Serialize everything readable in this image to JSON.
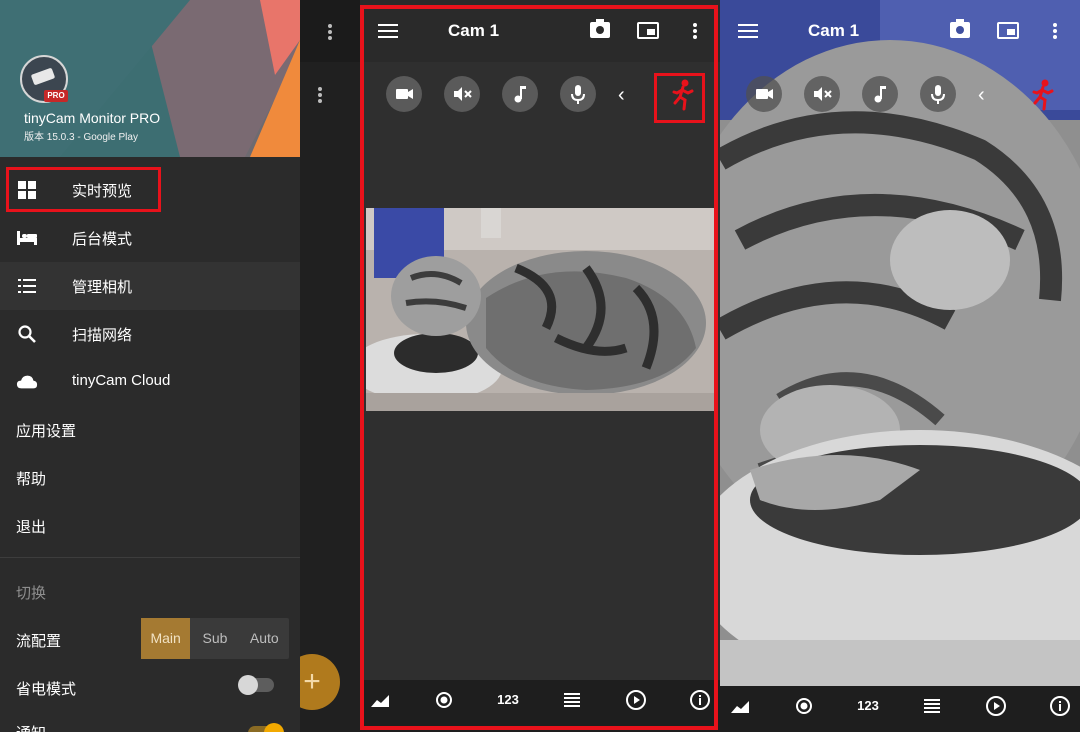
{
  "drawer": {
    "app_name": "tinyCam Monitor PRO",
    "app_version": "版本 15.0.3 - Google Play",
    "pro_badge": "PRO",
    "items": [
      {
        "label": "实时预览",
        "icon": "grid-icon"
      },
      {
        "label": "后台模式",
        "icon": "bed-icon"
      },
      {
        "label": "管理相机",
        "icon": "list-icon"
      },
      {
        "label": "扫描网络",
        "icon": "search-icon"
      },
      {
        "label": "tinyCam Cloud",
        "icon": "cloud-icon"
      },
      {
        "label": "应用设置"
      },
      {
        "label": "帮助"
      },
      {
        "label": "退出"
      }
    ],
    "section_title": "切换",
    "stream_label": "流配置",
    "stream_options": [
      "Main",
      "Sub",
      "Auto"
    ],
    "stream_selected": "Main",
    "power_label": "省电模式",
    "power_on": false,
    "notify_label": "通知",
    "notify_on": true,
    "fab_label": "+"
  },
  "camera": {
    "title": "Cam 1",
    "controls": [
      "video-icon",
      "mute-icon",
      "music-icon",
      "mic-icon",
      "chevron-left-icon",
      "motion-runner-icon"
    ],
    "bottom_bar": [
      "graph-icon",
      "target-icon",
      "123",
      "list-icon",
      "play-icon",
      "info-icon"
    ]
  },
  "colors": {
    "highlight": "#e8121b",
    "accent": "#a57a32",
    "toggle_on": "#f2a900"
  }
}
